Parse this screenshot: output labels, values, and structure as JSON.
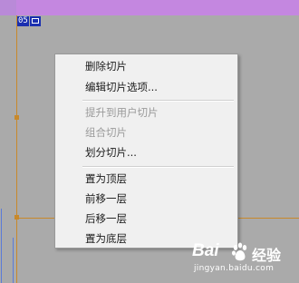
{
  "slice": {
    "number": "05"
  },
  "context_menu": {
    "items": [
      {
        "label": "删除切片",
        "enabled": true
      },
      {
        "label": "编辑切片选项...",
        "enabled": true
      },
      {
        "label": "提升到用户切片",
        "enabled": false
      },
      {
        "label": "组合切片",
        "enabled": false
      },
      {
        "label": "划分切片...",
        "enabled": true
      },
      {
        "label": "置为顶层",
        "enabled": true
      },
      {
        "label": "前移一层",
        "enabled": true
      },
      {
        "label": "后移一层",
        "enabled": true
      },
      {
        "label": "置为底层",
        "enabled": true
      }
    ]
  },
  "watermark": {
    "brand_left": "Bai",
    "brand_right": "经验",
    "url": "jingyan.baidu.com"
  },
  "colors": {
    "canvas": "#aaaaaa",
    "top_band": "#c487e0",
    "slice_edge": "#c8892b",
    "slice_badge": "#1a2fb0"
  }
}
